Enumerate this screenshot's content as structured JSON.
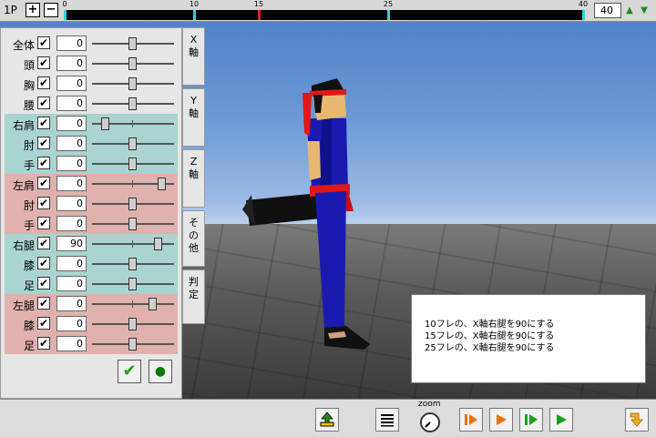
{
  "topbar": {
    "player_label": "1P",
    "plus_label": "+",
    "minus_label": "−",
    "timeline_markers": [
      "0",
      "10",
      "15",
      "25",
      "40"
    ],
    "frame_value": "40",
    "up_arrow": "▲",
    "down_arrow": "▼"
  },
  "panel": {
    "rows": [
      {
        "label": "全体",
        "checked": "✔",
        "value": "0"
      },
      {
        "label": "頭",
        "checked": "✔",
        "value": "0"
      },
      {
        "label": "胸",
        "checked": "✔",
        "value": "0"
      },
      {
        "label": "腰",
        "checked": "✔",
        "value": "0"
      },
      {
        "label": "右肩",
        "checked": "✔",
        "value": "0"
      },
      {
        "label": "肘",
        "checked": "✔",
        "value": "0"
      },
      {
        "label": "手",
        "checked": "✔",
        "value": "0"
      },
      {
        "label": "左肩",
        "checked": "✔",
        "value": "0"
      },
      {
        "label": "肘",
        "checked": "✔",
        "value": "0"
      },
      {
        "label": "手",
        "checked": "✔",
        "value": "0"
      },
      {
        "label": "右腿",
        "checked": "✔",
        "value": "90"
      },
      {
        "label": "膝",
        "checked": "✔",
        "value": "0"
      },
      {
        "label": "足",
        "checked": "✔",
        "value": "0"
      },
      {
        "label": "左腿",
        "checked": "✔",
        "value": "0"
      },
      {
        "label": "膝",
        "checked": "✔",
        "value": "0"
      },
      {
        "label": "足",
        "checked": "✔",
        "value": "0"
      }
    ],
    "ok_icon": "✔",
    "record_icon": "●"
  },
  "tabs": [
    {
      "label": "X\n軸"
    },
    {
      "label": "Y\n軸"
    },
    {
      "label": "Z\n軸"
    },
    {
      "label": "そ\nの\n他"
    },
    {
      "label": "判\n定"
    }
  ],
  "info": {
    "lines": [
      "10フレの、X軸右腿を90にする",
      "15フレの、X軸右腿を90にする",
      "25フレの、X軸右腿を90にする"
    ]
  },
  "bottombar": {
    "zoom_label": "zoom"
  },
  "colors": {
    "blue_group": "#a9d4d0",
    "red_group": "#e0b1ad",
    "timeline_cyan": "#30d0e0",
    "timeline_red": "#e02020",
    "play_green": "#1aa01a",
    "play_orange": "#f07000"
  }
}
